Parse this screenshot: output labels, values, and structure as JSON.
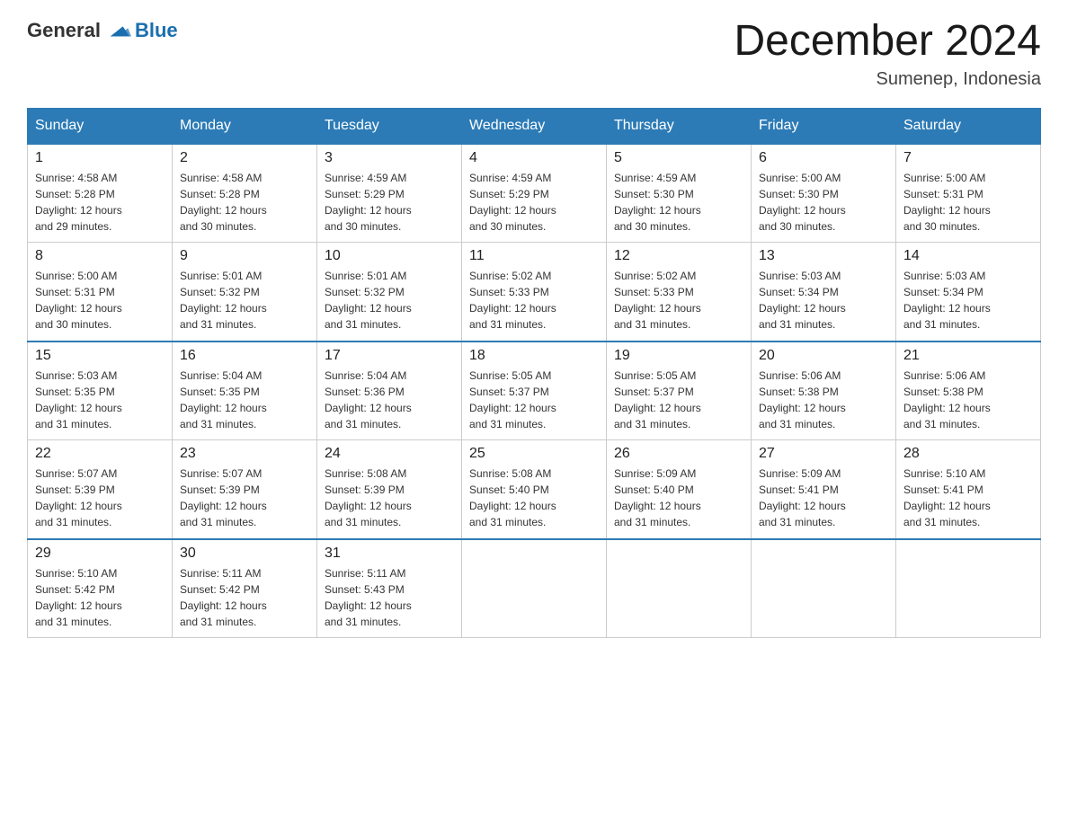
{
  "header": {
    "logo_general": "General",
    "logo_blue": "Blue",
    "month_title": "December 2024",
    "location": "Sumenep, Indonesia"
  },
  "days_of_week": [
    "Sunday",
    "Monday",
    "Tuesday",
    "Wednesday",
    "Thursday",
    "Friday",
    "Saturday"
  ],
  "weeks": [
    [
      {
        "day": "1",
        "sunrise": "4:58 AM",
        "sunset": "5:28 PM",
        "daylight": "12 hours and 29 minutes."
      },
      {
        "day": "2",
        "sunrise": "4:58 AM",
        "sunset": "5:28 PM",
        "daylight": "12 hours and 30 minutes."
      },
      {
        "day": "3",
        "sunrise": "4:59 AM",
        "sunset": "5:29 PM",
        "daylight": "12 hours and 30 minutes."
      },
      {
        "day": "4",
        "sunrise": "4:59 AM",
        "sunset": "5:29 PM",
        "daylight": "12 hours and 30 minutes."
      },
      {
        "day": "5",
        "sunrise": "4:59 AM",
        "sunset": "5:30 PM",
        "daylight": "12 hours and 30 minutes."
      },
      {
        "day": "6",
        "sunrise": "5:00 AM",
        "sunset": "5:30 PM",
        "daylight": "12 hours and 30 minutes."
      },
      {
        "day": "7",
        "sunrise": "5:00 AM",
        "sunset": "5:31 PM",
        "daylight": "12 hours and 30 minutes."
      }
    ],
    [
      {
        "day": "8",
        "sunrise": "5:00 AM",
        "sunset": "5:31 PM",
        "daylight": "12 hours and 30 minutes."
      },
      {
        "day": "9",
        "sunrise": "5:01 AM",
        "sunset": "5:32 PM",
        "daylight": "12 hours and 31 minutes."
      },
      {
        "day": "10",
        "sunrise": "5:01 AM",
        "sunset": "5:32 PM",
        "daylight": "12 hours and 31 minutes."
      },
      {
        "day": "11",
        "sunrise": "5:02 AM",
        "sunset": "5:33 PM",
        "daylight": "12 hours and 31 minutes."
      },
      {
        "day": "12",
        "sunrise": "5:02 AM",
        "sunset": "5:33 PM",
        "daylight": "12 hours and 31 minutes."
      },
      {
        "day": "13",
        "sunrise": "5:03 AM",
        "sunset": "5:34 PM",
        "daylight": "12 hours and 31 minutes."
      },
      {
        "day": "14",
        "sunrise": "5:03 AM",
        "sunset": "5:34 PM",
        "daylight": "12 hours and 31 minutes."
      }
    ],
    [
      {
        "day": "15",
        "sunrise": "5:03 AM",
        "sunset": "5:35 PM",
        "daylight": "12 hours and 31 minutes."
      },
      {
        "day": "16",
        "sunrise": "5:04 AM",
        "sunset": "5:35 PM",
        "daylight": "12 hours and 31 minutes."
      },
      {
        "day": "17",
        "sunrise": "5:04 AM",
        "sunset": "5:36 PM",
        "daylight": "12 hours and 31 minutes."
      },
      {
        "day": "18",
        "sunrise": "5:05 AM",
        "sunset": "5:37 PM",
        "daylight": "12 hours and 31 minutes."
      },
      {
        "day": "19",
        "sunrise": "5:05 AM",
        "sunset": "5:37 PM",
        "daylight": "12 hours and 31 minutes."
      },
      {
        "day": "20",
        "sunrise": "5:06 AM",
        "sunset": "5:38 PM",
        "daylight": "12 hours and 31 minutes."
      },
      {
        "day": "21",
        "sunrise": "5:06 AM",
        "sunset": "5:38 PM",
        "daylight": "12 hours and 31 minutes."
      }
    ],
    [
      {
        "day": "22",
        "sunrise": "5:07 AM",
        "sunset": "5:39 PM",
        "daylight": "12 hours and 31 minutes."
      },
      {
        "day": "23",
        "sunrise": "5:07 AM",
        "sunset": "5:39 PM",
        "daylight": "12 hours and 31 minutes."
      },
      {
        "day": "24",
        "sunrise": "5:08 AM",
        "sunset": "5:39 PM",
        "daylight": "12 hours and 31 minutes."
      },
      {
        "day": "25",
        "sunrise": "5:08 AM",
        "sunset": "5:40 PM",
        "daylight": "12 hours and 31 minutes."
      },
      {
        "day": "26",
        "sunrise": "5:09 AM",
        "sunset": "5:40 PM",
        "daylight": "12 hours and 31 minutes."
      },
      {
        "day": "27",
        "sunrise": "5:09 AM",
        "sunset": "5:41 PM",
        "daylight": "12 hours and 31 minutes."
      },
      {
        "day": "28",
        "sunrise": "5:10 AM",
        "sunset": "5:41 PM",
        "daylight": "12 hours and 31 minutes."
      }
    ],
    [
      {
        "day": "29",
        "sunrise": "5:10 AM",
        "sunset": "5:42 PM",
        "daylight": "12 hours and 31 minutes."
      },
      {
        "day": "30",
        "sunrise": "5:11 AM",
        "sunset": "5:42 PM",
        "daylight": "12 hours and 31 minutes."
      },
      {
        "day": "31",
        "sunrise": "5:11 AM",
        "sunset": "5:43 PM",
        "daylight": "12 hours and 31 minutes."
      },
      null,
      null,
      null,
      null
    ]
  ],
  "labels": {
    "sunrise_prefix": "Sunrise: ",
    "sunset_prefix": "Sunset: ",
    "daylight_prefix": "Daylight: "
  }
}
